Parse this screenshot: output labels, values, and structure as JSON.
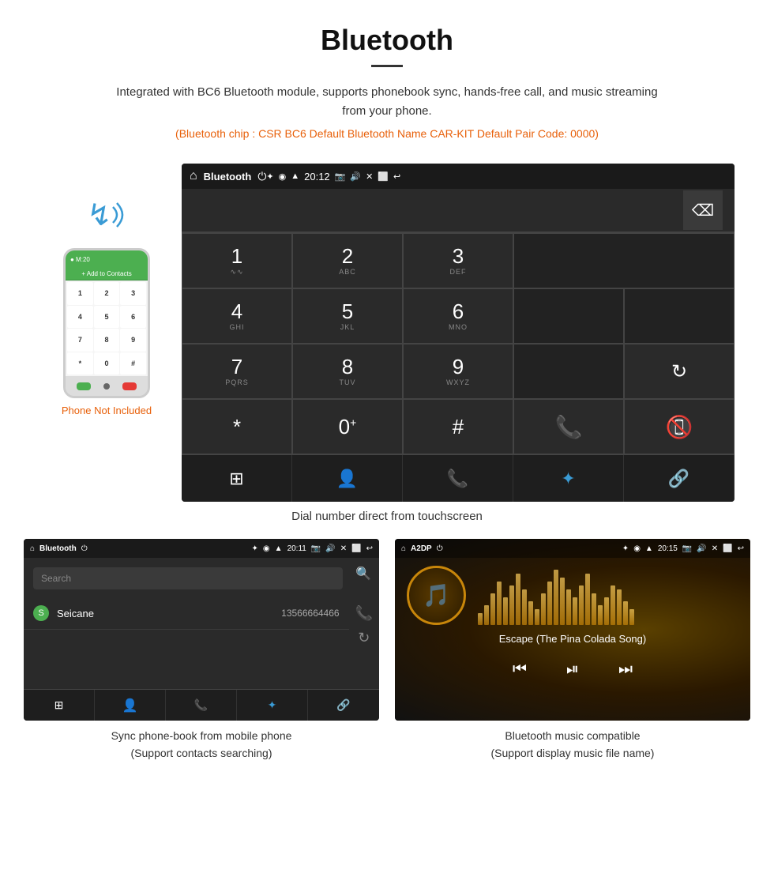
{
  "header": {
    "title": "Bluetooth",
    "description": "Integrated with BC6 Bluetooth module, supports phonebook sync, hands-free call, and music streaming from your phone.",
    "techSpecs": "(Bluetooth chip : CSR BC6    Default Bluetooth Name CAR-KIT    Default Pair Code: 0000)"
  },
  "dialScreen": {
    "statusBar": {
      "appName": "Bluetooth",
      "time": "20:12"
    },
    "keys": [
      {
        "num": "1",
        "sub": "⌄⌄"
      },
      {
        "num": "2",
        "sub": "ABC"
      },
      {
        "num": "3",
        "sub": "DEF"
      },
      {
        "num": "4",
        "sub": "GHI"
      },
      {
        "num": "5",
        "sub": "JKL"
      },
      {
        "num": "6",
        "sub": "MNO"
      },
      {
        "num": "7",
        "sub": "PQRS"
      },
      {
        "num": "8",
        "sub": "TUV"
      },
      {
        "num": "9",
        "sub": "WXYZ"
      },
      {
        "num": "*",
        "sub": ""
      },
      {
        "num": "0",
        "sub": "+"
      },
      {
        "num": "#",
        "sub": ""
      }
    ],
    "caption": "Dial number direct from touchscreen"
  },
  "phonebookScreen": {
    "statusBar": {
      "appName": "Bluetooth",
      "time": "20:11"
    },
    "searchPlaceholder": "Search",
    "contact": {
      "letter": "S",
      "name": "Seicane",
      "number": "13566664466"
    },
    "caption1": "Sync phone-book from mobile phone",
    "caption2": "(Support contacts searching)"
  },
  "musicScreen": {
    "statusBar": {
      "appName": "A2DP",
      "time": "20:15"
    },
    "songTitle": "Escape (The Pina Colada Song)",
    "caption1": "Bluetooth music compatible",
    "caption2": "(Support display music file name)"
  },
  "phoneNotIncluded": "Phone Not Included",
  "watermark": "Seicane",
  "musicBars": [
    15,
    25,
    40,
    55,
    35,
    50,
    65,
    45,
    30,
    20,
    40,
    55,
    70,
    60,
    45,
    35,
    50,
    65,
    40,
    25,
    35,
    50,
    45,
    30,
    20
  ]
}
